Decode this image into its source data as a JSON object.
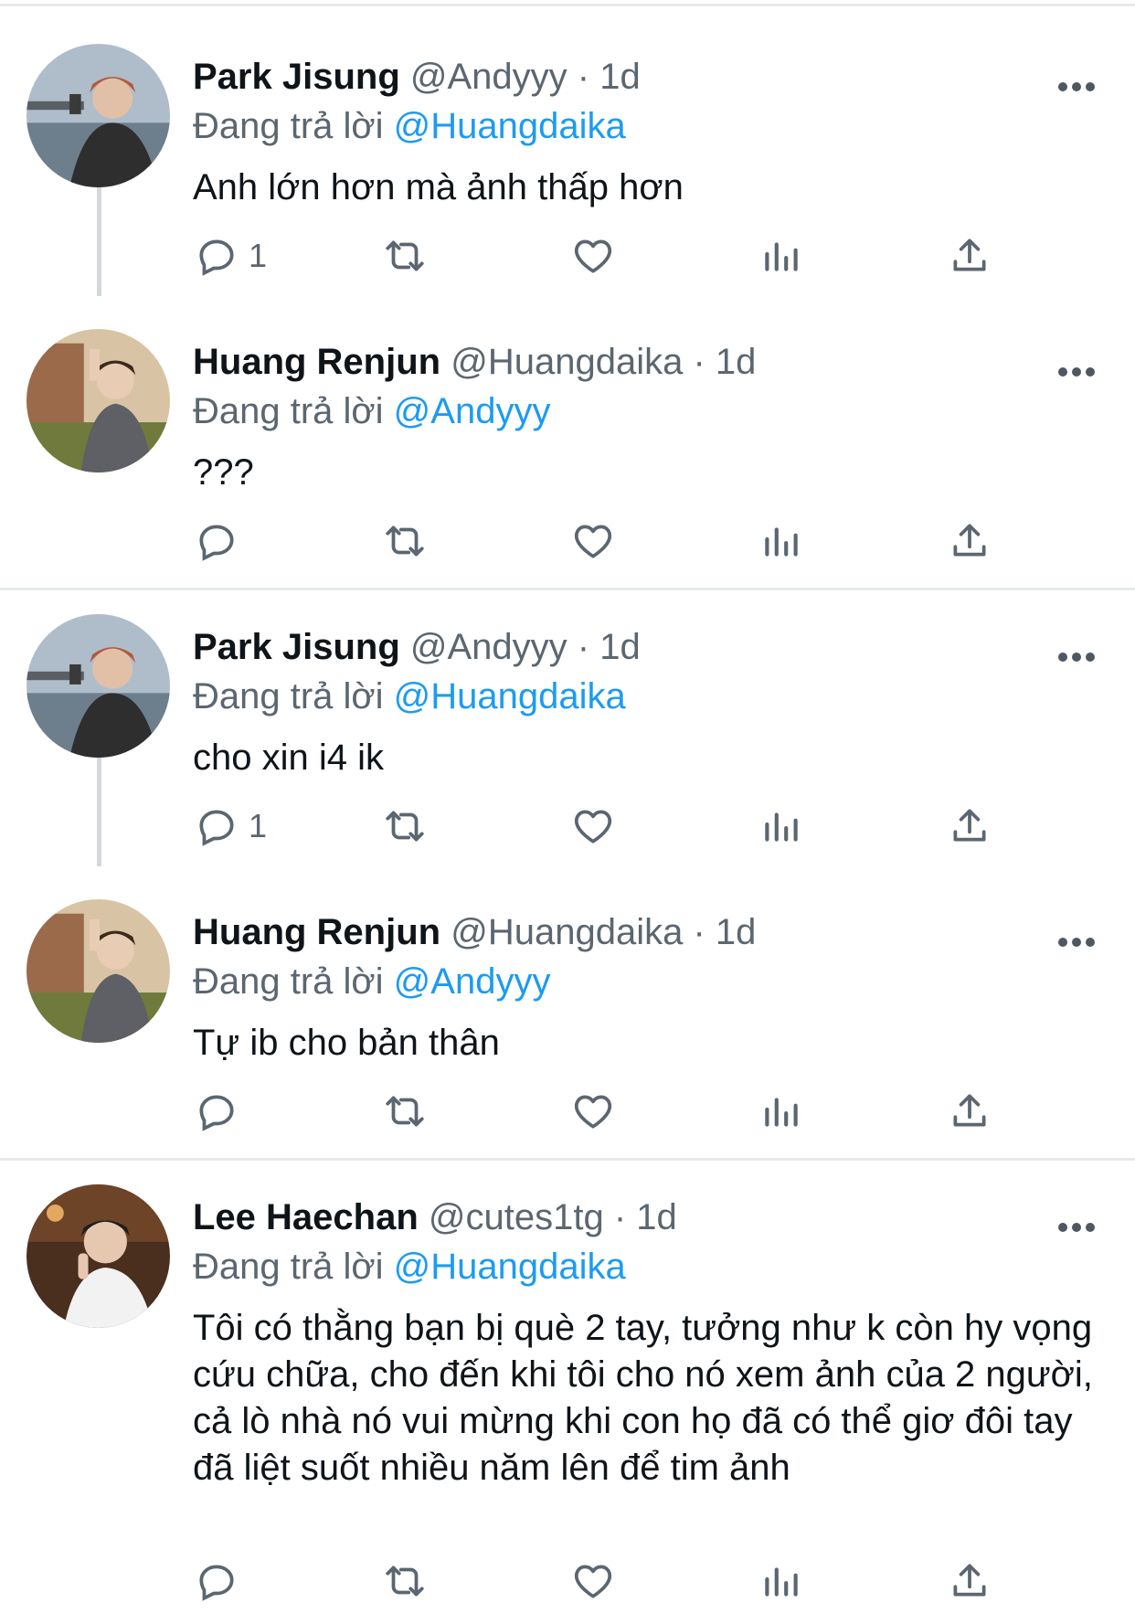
{
  "tweets": [
    {
      "name": "Park Jisung",
      "handle": "@Andyyy",
      "time": "· 1d",
      "reply_prefix": "Đang trả lời",
      "reply_to": "@Huangdaika",
      "text": "Anh lớn hơn mà ảnh thấp hơn",
      "reply_count": "1",
      "avatar": "avatar-park-jisung"
    },
    {
      "name": "Huang Renjun",
      "handle": "@Huangdaika",
      "time": "· 1d",
      "reply_prefix": "Đang trả lời",
      "reply_to": "@Andyyy",
      "text": "???",
      "reply_count": "",
      "avatar": "avatar-huang-renjun"
    },
    {
      "name": "Park Jisung",
      "handle": "@Andyyy",
      "time": "· 1d",
      "reply_prefix": "Đang trả lời",
      "reply_to": "@Huangdaika",
      "text": "cho xin i4 ik",
      "reply_count": "1",
      "avatar": "avatar-park-jisung"
    },
    {
      "name": "Huang Renjun",
      "handle": "@Huangdaika",
      "time": "· 1d",
      "reply_prefix": "Đang trả lời",
      "reply_to": "@Andyyy",
      "text": "Tự ib cho bản thân",
      "reply_count": "",
      "avatar": "avatar-huang-renjun"
    },
    {
      "name": "Lee Haechan",
      "handle": "@cutes1tg",
      "time": "· 1d",
      "reply_prefix": "Đang trả lời",
      "reply_to": "@Huangdaika",
      "text": "Tôi có thằng bạn bị què 2 tay, tưởng như k còn hy vọng cứu chữa, cho đến khi tôi cho nó xem ảnh của 2 người, cả lò nhà nó vui mừng khi con họ đã có thể giơ đôi tay đã liệt suốt nhiều năm lên để tim ảnh",
      "reply_count": "",
      "avatar": "avatar-lee-haechan"
    }
  ],
  "icons": {
    "reply": "speech-bubble-icon",
    "retweet": "retweet-icon",
    "like": "heart-icon",
    "analytics": "bar-chart-icon",
    "share": "share-upload-icon",
    "more": "more-dots-icon"
  },
  "colors": {
    "mention": "#1d9bf0",
    "secondary_text": "#5b6670",
    "primary_text": "#0f1419",
    "divider": "#e6e9eb",
    "thread_line": "#d3d8dc"
  }
}
